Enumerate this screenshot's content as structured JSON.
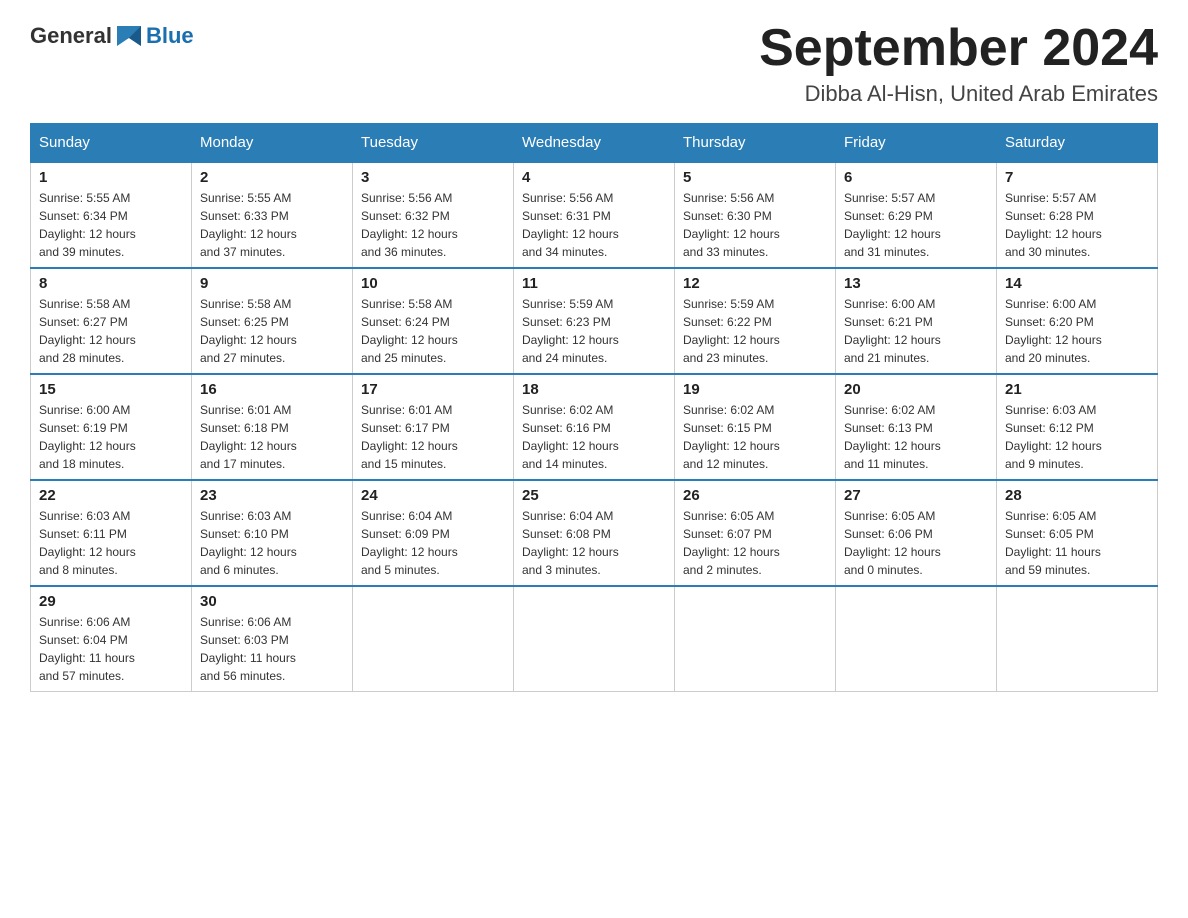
{
  "header": {
    "title": "September 2024",
    "location": "Dibba Al-Hisn, United Arab Emirates",
    "logo_general": "General",
    "logo_blue": "Blue"
  },
  "days_of_week": [
    "Sunday",
    "Monday",
    "Tuesday",
    "Wednesday",
    "Thursday",
    "Friday",
    "Saturday"
  ],
  "weeks": [
    [
      {
        "day": "1",
        "sunrise": "5:55 AM",
        "sunset": "6:34 PM",
        "daylight": "12 hours and 39 minutes."
      },
      {
        "day": "2",
        "sunrise": "5:55 AM",
        "sunset": "6:33 PM",
        "daylight": "12 hours and 37 minutes."
      },
      {
        "day": "3",
        "sunrise": "5:56 AM",
        "sunset": "6:32 PM",
        "daylight": "12 hours and 36 minutes."
      },
      {
        "day": "4",
        "sunrise": "5:56 AM",
        "sunset": "6:31 PM",
        "daylight": "12 hours and 34 minutes."
      },
      {
        "day": "5",
        "sunrise": "5:56 AM",
        "sunset": "6:30 PM",
        "daylight": "12 hours and 33 minutes."
      },
      {
        "day": "6",
        "sunrise": "5:57 AM",
        "sunset": "6:29 PM",
        "daylight": "12 hours and 31 minutes."
      },
      {
        "day": "7",
        "sunrise": "5:57 AM",
        "sunset": "6:28 PM",
        "daylight": "12 hours and 30 minutes."
      }
    ],
    [
      {
        "day": "8",
        "sunrise": "5:58 AM",
        "sunset": "6:27 PM",
        "daylight": "12 hours and 28 minutes."
      },
      {
        "day": "9",
        "sunrise": "5:58 AM",
        "sunset": "6:25 PM",
        "daylight": "12 hours and 27 minutes."
      },
      {
        "day": "10",
        "sunrise": "5:58 AM",
        "sunset": "6:24 PM",
        "daylight": "12 hours and 25 minutes."
      },
      {
        "day": "11",
        "sunrise": "5:59 AM",
        "sunset": "6:23 PM",
        "daylight": "12 hours and 24 minutes."
      },
      {
        "day": "12",
        "sunrise": "5:59 AM",
        "sunset": "6:22 PM",
        "daylight": "12 hours and 23 minutes."
      },
      {
        "day": "13",
        "sunrise": "6:00 AM",
        "sunset": "6:21 PM",
        "daylight": "12 hours and 21 minutes."
      },
      {
        "day": "14",
        "sunrise": "6:00 AM",
        "sunset": "6:20 PM",
        "daylight": "12 hours and 20 minutes."
      }
    ],
    [
      {
        "day": "15",
        "sunrise": "6:00 AM",
        "sunset": "6:19 PM",
        "daylight": "12 hours and 18 minutes."
      },
      {
        "day": "16",
        "sunrise": "6:01 AM",
        "sunset": "6:18 PM",
        "daylight": "12 hours and 17 minutes."
      },
      {
        "day": "17",
        "sunrise": "6:01 AM",
        "sunset": "6:17 PM",
        "daylight": "12 hours and 15 minutes."
      },
      {
        "day": "18",
        "sunrise": "6:02 AM",
        "sunset": "6:16 PM",
        "daylight": "12 hours and 14 minutes."
      },
      {
        "day": "19",
        "sunrise": "6:02 AM",
        "sunset": "6:15 PM",
        "daylight": "12 hours and 12 minutes."
      },
      {
        "day": "20",
        "sunrise": "6:02 AM",
        "sunset": "6:13 PM",
        "daylight": "12 hours and 11 minutes."
      },
      {
        "day": "21",
        "sunrise": "6:03 AM",
        "sunset": "6:12 PM",
        "daylight": "12 hours and 9 minutes."
      }
    ],
    [
      {
        "day": "22",
        "sunrise": "6:03 AM",
        "sunset": "6:11 PM",
        "daylight": "12 hours and 8 minutes."
      },
      {
        "day": "23",
        "sunrise": "6:03 AM",
        "sunset": "6:10 PM",
        "daylight": "12 hours and 6 minutes."
      },
      {
        "day": "24",
        "sunrise": "6:04 AM",
        "sunset": "6:09 PM",
        "daylight": "12 hours and 5 minutes."
      },
      {
        "day": "25",
        "sunrise": "6:04 AM",
        "sunset": "6:08 PM",
        "daylight": "12 hours and 3 minutes."
      },
      {
        "day": "26",
        "sunrise": "6:05 AM",
        "sunset": "6:07 PM",
        "daylight": "12 hours and 2 minutes."
      },
      {
        "day": "27",
        "sunrise": "6:05 AM",
        "sunset": "6:06 PM",
        "daylight": "12 hours and 0 minutes."
      },
      {
        "day": "28",
        "sunrise": "6:05 AM",
        "sunset": "6:05 PM",
        "daylight": "11 hours and 59 minutes."
      }
    ],
    [
      {
        "day": "29",
        "sunrise": "6:06 AM",
        "sunset": "6:04 PM",
        "daylight": "11 hours and 57 minutes."
      },
      {
        "day": "30",
        "sunrise": "6:06 AM",
        "sunset": "6:03 PM",
        "daylight": "11 hours and 56 minutes."
      },
      null,
      null,
      null,
      null,
      null
    ]
  ]
}
